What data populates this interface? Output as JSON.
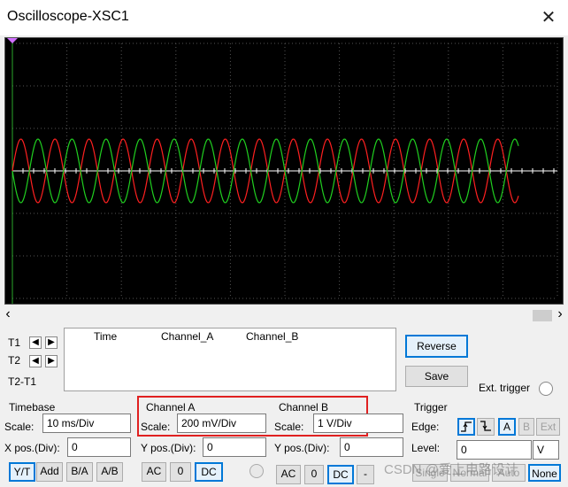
{
  "window": {
    "title": "Oscilloscope-XSC1",
    "close_glyph": "✕"
  },
  "screen": {
    "background": "#000000",
    "grid_color": "#555555",
    "channel_a_color": "#ff2020",
    "channel_b_color": "#20d020",
    "cursor_color": "#2aa82a"
  },
  "scroll": {
    "left_glyph": "‹",
    "right_glyph": "›"
  },
  "cursors": {
    "t1_label": "T1",
    "t2_label": "T2",
    "t2t1_label": "T2-T1",
    "col_time": "Time",
    "col_a": "Channel_A",
    "col_b": "Channel_B"
  },
  "buttons": {
    "reverse": "Reverse",
    "save": "Save",
    "ext_trigger": "Ext. trigger"
  },
  "timebase": {
    "title": "Timebase",
    "scale_label": "Scale:",
    "scale_value": "10 ms/Div",
    "xpos_label": "X pos.(Div):",
    "xpos_value": "0",
    "modes": [
      "Y/T",
      "Add",
      "B/A",
      "A/B"
    ]
  },
  "channel_a": {
    "title": "Channel A",
    "scale_label": "Scale:",
    "scale_value": "200 mV/Div",
    "ypos_label": "Y pos.(Div):",
    "ypos_value": "0",
    "coupling": [
      "AC",
      "0",
      "DC"
    ]
  },
  "channel_b": {
    "title": "Channel B",
    "scale_label": "Scale:",
    "scale_value": "1  V/Div",
    "ypos_label": "Y pos.(Div):",
    "ypos_value": "0",
    "coupling": [
      "AC",
      "0",
      "DC",
      "-"
    ]
  },
  "trigger": {
    "title": "Trigger",
    "edge_label": "Edge:",
    "sources": [
      "A",
      "B",
      "Ext"
    ],
    "level_label": "Level:",
    "level_value": "0",
    "level_unit": "V",
    "modes": [
      "Single",
      "Normal",
      "Auto",
      "None"
    ]
  },
  "watermark": "CSDN @爱上电路设计",
  "highlight_color": "#e02020"
}
